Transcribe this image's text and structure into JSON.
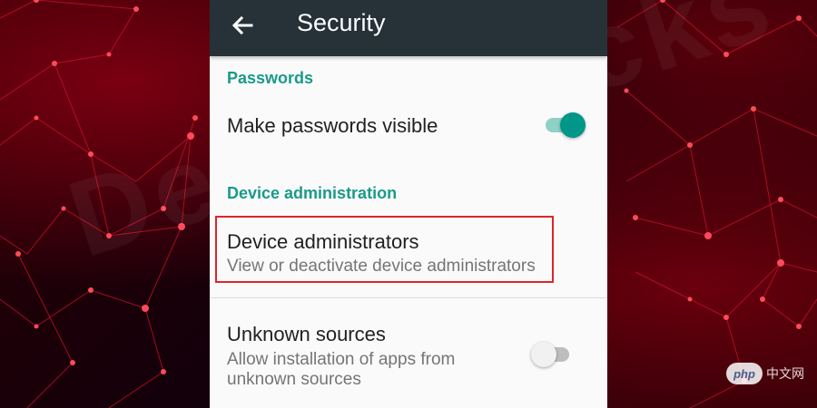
{
  "background": {
    "colors": {
      "base": "#1a0004",
      "line": "#e0102a",
      "node": "#ff4a5a"
    }
  },
  "watermark": {
    "text": "DeviceTricks"
  },
  "appbar": {
    "back_icon": "arrow-left-icon",
    "title": "Security",
    "color": "#263238"
  },
  "sections": {
    "passwords": {
      "header": "Passwords",
      "make_visible": {
        "title": "Make passwords visible",
        "enabled": true
      }
    },
    "device_admin": {
      "header": "Device administration",
      "administrators": {
        "title": "Device administrators",
        "summary": "View or deactivate device administrators"
      },
      "unknown_sources": {
        "title": "Unknown sources",
        "summary_line1": "Allow installation of apps from",
        "summary_line2": "unknown sources",
        "enabled": false
      }
    }
  },
  "accent_color": "#1a9a89",
  "highlight_color": "#e0242a",
  "corner_logo": {
    "pill": "php",
    "text": "中文网"
  }
}
